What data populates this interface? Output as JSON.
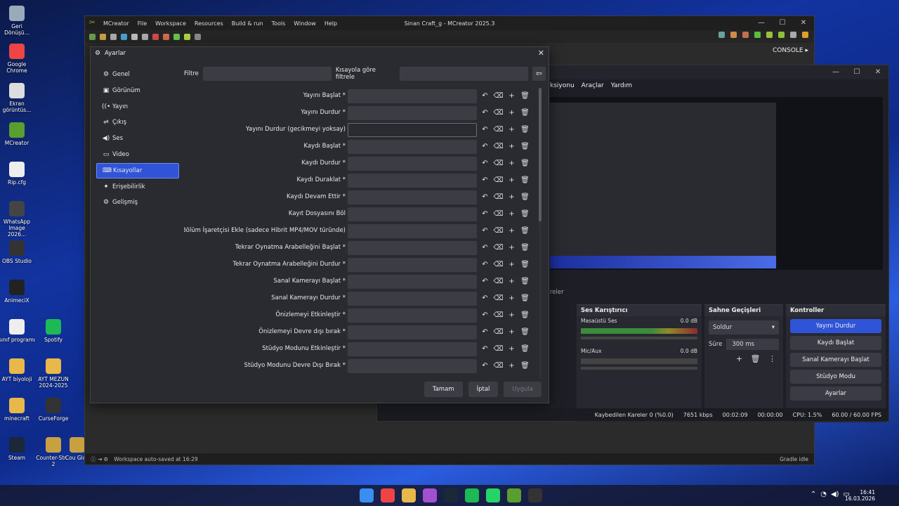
{
  "desktop": {
    "icons": [
      {
        "label": "Geri Dönüşü...",
        "color": "#9ab"
      },
      {
        "label": "Google Chrome",
        "color": "#e44"
      },
      {
        "label": "Ekran görüntüs...",
        "color": "#ddd"
      },
      {
        "label": "MCreator",
        "color": "#5a9e2f"
      },
      {
        "label": "Rip.cfg",
        "color": "#eee"
      },
      {
        "label": "WhatsApp Image 2026...",
        "color": "#444"
      },
      {
        "label": "OBS Studio",
        "color": "#333"
      },
      {
        "label": "AnimeciX",
        "color": "#222"
      },
      {
        "label": "sınıf programı",
        "color": "#eee"
      },
      {
        "label": "Spotify",
        "color": "#1db954"
      },
      {
        "label": "AYT biyoloji",
        "color": "#e8b84a"
      },
      {
        "label": "AYT MEZUN 2024-2025",
        "color": "#e8b84a"
      },
      {
        "label": "minecraft",
        "color": "#e8b84a"
      },
      {
        "label": "CurseForge",
        "color": "#333"
      },
      {
        "label": "Steam",
        "color": "#1b2838"
      },
      {
        "label": "Counter-Str... 2",
        "color": "#c8a040"
      },
      {
        "label": "Cou Glob",
        "color": "#c8a040"
      }
    ]
  },
  "mcreator": {
    "menu": [
      "MCreator",
      "File",
      "Workspace",
      "Resources",
      "Build & run",
      "Tools",
      "Window",
      "Help"
    ],
    "title": "Sinan Craft_g - MCreator 2025.3",
    "console_label": "CONSOLE ▸",
    "status_left": "Workspace auto-saved at 16:29",
    "status_right": "Gradle idle"
  },
  "obs": {
    "menu": [
      "ksiyonu",
      "Araçlar",
      "Yardım"
    ],
    "mixer_title": "Ses Karıştırıcı",
    "mixer_desktop": "Masaüstü Ses",
    "mixer_desktop_db": "0.0 dB",
    "mixer_mic": "Mic/Aux",
    "mixer_mic_db": "0.0 dB",
    "transitions_title": "Sahne Geçişleri",
    "transition_select": "Soldur",
    "duration_label": "Süre",
    "duration_value": "300 ms",
    "controls_title": "Kontroller",
    "controls": [
      "Yayını Durdur",
      "Kaydı Başlat",
      "Sanal Kamerayı Başlat",
      "Stüdyo Modu",
      "Ayarlar"
    ],
    "left_partial": "reler",
    "status": [
      "Kaybedilen Kareler 0 (%0.0)",
      "7651 kbps",
      "00:02:09",
      "00:00:00",
      "CPU: 1.5%",
      "60.00 / 60.00 FPS"
    ]
  },
  "dialog": {
    "title": "Ayarlar",
    "sidebar": [
      {
        "icon": "⚙",
        "label": "Genel"
      },
      {
        "icon": "▣",
        "label": "Görünüm"
      },
      {
        "icon": "((•",
        "label": "Yayın"
      },
      {
        "icon": "⇌",
        "label": "Çıkış"
      },
      {
        "icon": "◀)",
        "label": "Ses"
      },
      {
        "icon": "▭",
        "label": "Video"
      },
      {
        "icon": "⌨",
        "label": "Kısayollar"
      },
      {
        "icon": "✦",
        "label": "Erişebilirlik"
      },
      {
        "icon": "⚙",
        "label": "Gelişmiş"
      }
    ],
    "active_index": 6,
    "filter_label": "Filtre",
    "filter_value": "",
    "shortcut_filter_label": "Kısayola göre filtrele",
    "shortcut_filter_value": "",
    "hotkeys": [
      "Yayını Başlat *",
      "Yayını Durdur *",
      "Yayını Durdur (gecikmeyi yoksay)",
      "Kaydı Başlat *",
      "Kaydı Durdur *",
      "Kaydı Duraklat *",
      "Kaydı Devam Ettir *",
      "Kayıt Dosyasını Böl",
      "Bölüm İşaretçisi Ekle (sadece Hibrit MP4/MOV türünde)",
      "Tekrar Oynatma Arabelleğini Başlat *",
      "Tekrar Oynatma Arabelleğini Durdur *",
      "Sanal Kamerayı Başlat *",
      "Sanal Kamerayı Durdur *",
      "Önizlemeyi Etkinleştir *",
      "Önizlemeyi Devre dışı bırak *",
      "Stüdyo Modunu Etkinleştir *",
      "Stüdyo Modunu Devre Dışı Bırak *"
    ],
    "focused_index": 2,
    "buttons": {
      "ok": "Tamam",
      "cancel": "İptal",
      "apply": "Uygula"
    }
  },
  "taskbar": {
    "time": "16:41",
    "date": "16.03.2026"
  }
}
